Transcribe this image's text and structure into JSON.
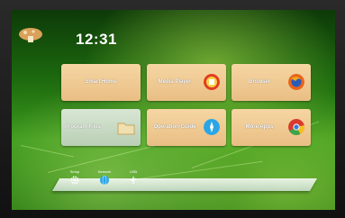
{
  "status_bar": {
    "logo_icon": "mushroom-logo-icon",
    "time": "12:31"
  },
  "tiles": [
    {
      "label": "Smart Home",
      "icon": "none"
    },
    {
      "label": "Media Player",
      "icon": "media-player-icon"
    },
    {
      "label": "Browser",
      "icon": "firefox-icon"
    },
    {
      "label": "Program Files",
      "icon": "folder-icon"
    },
    {
      "label": "Operation Guide",
      "icon": "compass-icon"
    },
    {
      "label": "More Apps",
      "icon": "chrome-icon"
    }
  ],
  "dock": {
    "items": [
      {
        "label": "Setup",
        "icon": "gear-icon"
      },
      {
        "label": "Network",
        "icon": "globe-icon"
      },
      {
        "label": "USB",
        "icon": "usb-icon"
      }
    ]
  },
  "colors": {
    "tile": "#f0ca92",
    "tile_selected": "#c8dbc3",
    "wallpaper": "#2a7d12"
  }
}
